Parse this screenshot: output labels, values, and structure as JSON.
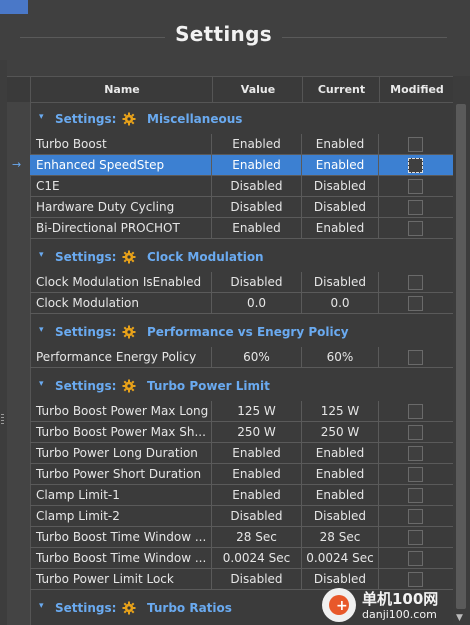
{
  "window": {
    "title": "Settings"
  },
  "columns": {
    "name": "Name",
    "value": "Value",
    "current": "Current",
    "modified": "Modified"
  },
  "section_prefix": "Settings:",
  "sections": [
    {
      "title": "Miscellaneous",
      "rows": [
        {
          "name": "Turbo Boost",
          "value": "Enabled",
          "current": "Enabled",
          "modified": false
        },
        {
          "name": "Enhanced SpeedStep",
          "value": "Enabled",
          "current": "Enabled",
          "modified": false,
          "selected": true
        },
        {
          "name": "C1E",
          "value": "Disabled",
          "current": "Disabled",
          "modified": false
        },
        {
          "name": "Hardware Duty Cycling",
          "value": "Disabled",
          "current": "Disabled",
          "modified": false
        },
        {
          "name": "Bi-Directional PROCHOT",
          "value": "Enabled",
          "current": "Enabled",
          "modified": false
        }
      ]
    },
    {
      "title": "Clock Modulation",
      "rows": [
        {
          "name": "Clock Modulation IsEnabled",
          "value": "Disabled",
          "current": "Disabled",
          "modified": false
        },
        {
          "name": "Clock Modulation",
          "value": "0.0",
          "current": "0.0",
          "modified": false
        }
      ]
    },
    {
      "title": "Performance vs Enegry Policy",
      "rows": [
        {
          "name": "Performance Energy Policy",
          "value": "60%",
          "current": "60%",
          "modified": false
        }
      ]
    },
    {
      "title": "Turbo Power Limit",
      "rows": [
        {
          "name": "Turbo Boost Power Max Long",
          "value": "125 W",
          "current": "125 W",
          "modified": false
        },
        {
          "name": "Turbo Boost Power Max Sh...",
          "value": "250 W",
          "current": "250 W",
          "modified": false
        },
        {
          "name": "Turbo Power Long Duration",
          "value": "Enabled",
          "current": "Enabled",
          "modified": false
        },
        {
          "name": "Turbo Power Short Duration",
          "value": "Enabled",
          "current": "Enabled",
          "modified": false
        },
        {
          "name": "Clamp Limit-1",
          "value": "Enabled",
          "current": "Enabled",
          "modified": false
        },
        {
          "name": "Clamp Limit-2",
          "value": "Disabled",
          "current": "Disabled",
          "modified": false
        },
        {
          "name": "Turbo Boost Time Window ...",
          "value": "28 Sec",
          "current": "28 Sec",
          "modified": false
        },
        {
          "name": "Turbo Boost Time Window ...",
          "value": "0.0024 Sec",
          "current": "0.0024 Sec",
          "modified": false
        },
        {
          "name": "Turbo Power Limit Lock",
          "value": "Disabled",
          "current": "Disabled",
          "modified": false
        }
      ]
    },
    {
      "title": "Turbo Ratios",
      "rows": []
    }
  ],
  "watermark": {
    "text1": "单机100网",
    "text2": "danji100.com",
    "plus": "+"
  },
  "glyphs": {
    "expanded": "▾",
    "row_pointer": "→",
    "scroll_down": "▼"
  },
  "colors": {
    "accent": "#3c80d2",
    "section": "#6aaaf0",
    "gear": "#e8a21a"
  }
}
